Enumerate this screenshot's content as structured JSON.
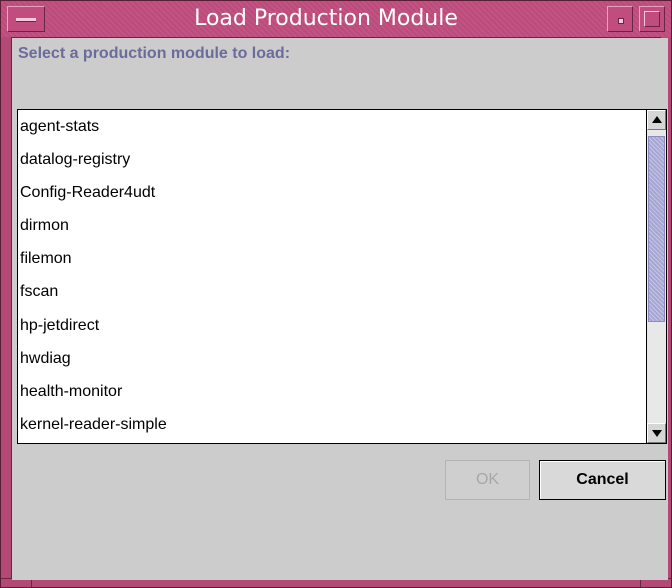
{
  "window": {
    "title": "Load Production Module",
    "accent_color": "#c04d7e"
  },
  "dialog": {
    "prompt": "Select a production module to load:",
    "items": [
      "agent-stats",
      "datalog-registry",
      "Config-Reader4udt",
      "dirmon",
      "filemon",
      "fscan",
      "hp-jetdirect",
      "hwdiag",
      "health-monitor",
      "kernel-reader-simple"
    ],
    "scroll_thumb_color": "#a6a6d4"
  },
  "buttons": {
    "ok_label": "OK",
    "ok_enabled": false,
    "cancel_label": "Cancel"
  },
  "icons": {
    "window_menu": "window-menu-icon",
    "minimize": "minimize-icon",
    "maximize": "maximize-icon",
    "scroll_up": "arrow-up-icon",
    "scroll_down": "arrow-down-icon"
  }
}
